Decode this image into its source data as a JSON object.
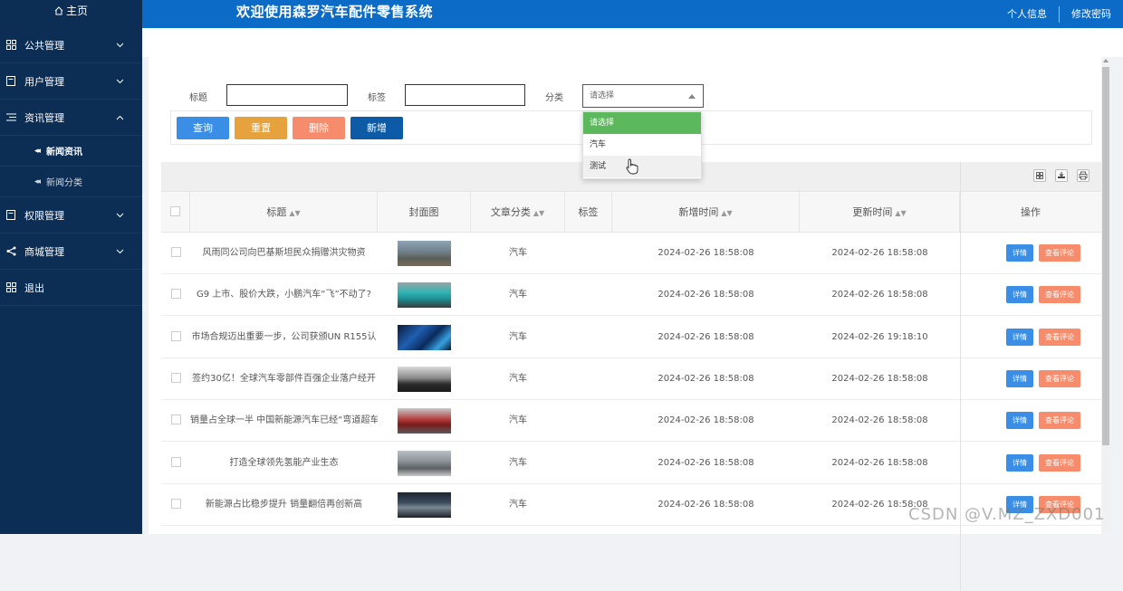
{
  "sidebar": {
    "home": "主页",
    "items": [
      {
        "label": "公共管理",
        "icon": "grid-icon",
        "chevron": "down"
      },
      {
        "label": "用户管理",
        "icon": "document-icon",
        "chevron": "down"
      },
      {
        "label": "资讯管理",
        "icon": "list-icon",
        "chevron": "up"
      }
    ],
    "subitems": [
      {
        "label": "新闻资讯",
        "active": true
      },
      {
        "label": "新闻分类",
        "active": false
      }
    ],
    "items_after": [
      {
        "label": "权限管理",
        "icon": "document-icon",
        "chevron": "down"
      },
      {
        "label": "商城管理",
        "icon": "share-icon",
        "chevron": "down"
      },
      {
        "label": "退出",
        "icon": "grid-icon",
        "chevron": ""
      }
    ]
  },
  "header": {
    "title": "欢迎使用森罗汽车配件零售系统",
    "profile": "个人信息",
    "change_password": "修改密码"
  },
  "search": {
    "title_label": "标题",
    "tag_label": "标签",
    "category_label": "分类",
    "category_value": "请选择"
  },
  "buttons": {
    "query": "查询",
    "reset": "重置",
    "delete": "删除",
    "add": "新增"
  },
  "dropdown": {
    "options": [
      "请选择",
      "汽车",
      "测试"
    ]
  },
  "table": {
    "headers": {
      "title": "标题",
      "cover": "封面图",
      "category": "文章分类",
      "tag": "标签",
      "created": "新增时间",
      "updated": "更新时间",
      "action": "操作"
    },
    "detail_label": "详情",
    "comment_label": "查看评论",
    "rows": [
      {
        "title": "风雨同公司向巴基斯坦民众捐赠洪灾物资",
        "category": "汽车",
        "tag": "",
        "created": "2024-02-26 18:58:08",
        "updated": "2024-02-26 18:58:08"
      },
      {
        "title": "G9 上市、股价大跌，小鹏汽车“飞”不动了?",
        "category": "汽车",
        "tag": "",
        "created": "2024-02-26 18:58:08",
        "updated": "2024-02-26 18:58:08"
      },
      {
        "title": "市场合规迈出重要一步，公司获颁UN R155认",
        "category": "汽车",
        "tag": "",
        "created": "2024-02-26 18:58:08",
        "updated": "2024-02-26 19:18:10"
      },
      {
        "title": "签约30亿！全球汽车零部件百强企业落户经开",
        "category": "汽车",
        "tag": "",
        "created": "2024-02-26 18:58:08",
        "updated": "2024-02-26 18:58:08"
      },
      {
        "title": "销量占全球一半 中国新能源汽车已经“弯道超车",
        "category": "汽车",
        "tag": "",
        "created": "2024-02-26 18:58:08",
        "updated": "2024-02-26 18:58:08"
      },
      {
        "title": "打造全球领先氢能产业生态",
        "category": "汽车",
        "tag": "",
        "created": "2024-02-26 18:58:08",
        "updated": "2024-02-26 18:58:08"
      },
      {
        "title": "新能源占比稳步提升 销量翻倍再创新高",
        "category": "汽车",
        "tag": "",
        "created": "2024-02-26 18:58:08",
        "updated": "2024-02-26 18:58:08"
      }
    ]
  },
  "watermark": "CSDN @V.MZ_ZXD001",
  "colors": {
    "sidebar": "#0c2d54",
    "header": "#0d6bc8",
    "query": "#3a8ee6",
    "reset": "#e6a23c",
    "delete": "#f78c6c",
    "add": "#0d5aa7",
    "dropdown_selected": "#5cb85c",
    "detail": "#3a8ee6",
    "comment": "#f78c6c"
  }
}
